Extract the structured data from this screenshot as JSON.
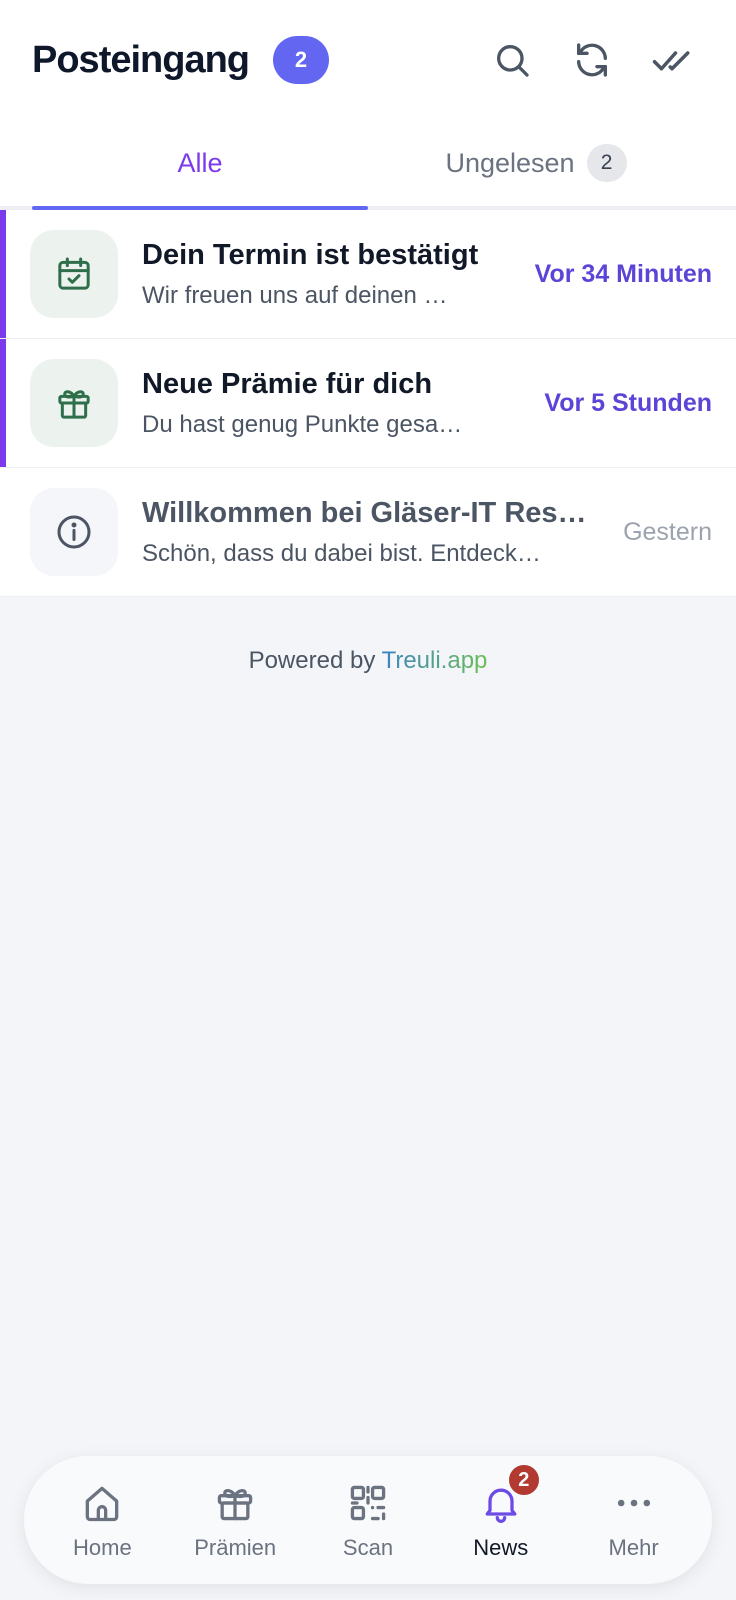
{
  "header": {
    "title": "Posteingang",
    "unread_count": "2",
    "actions": [
      "search-icon",
      "refresh-icon",
      "mark-all-read-icon"
    ]
  },
  "tabs": [
    {
      "label": "Alle",
      "active": true
    },
    {
      "label": "Ungelesen",
      "count": "2",
      "active": false
    }
  ],
  "messages": [
    {
      "icon": "calendar-check-icon",
      "title": "Dein Termin ist bestätigt",
      "preview": "Wir freuen uns auf deinen …",
      "time": "Vor 34 Minuten",
      "unread": true
    },
    {
      "icon": "gift-icon",
      "title": "Neue Prämie für dich",
      "preview": "Du hast genug Punkte gesa…",
      "time": "Vor 5 Stunden",
      "unread": true
    },
    {
      "icon": "info-icon",
      "title": "Willkommen bei Gläser-IT Res…",
      "preview": "Schön, dass du dabei bist. Entdeck…",
      "time": "Gestern",
      "unread": false
    }
  ],
  "footer": {
    "prefix": "Powered by ",
    "brand": "Treuli.app"
  },
  "bottom_nav": [
    {
      "label": "Home",
      "icon": "home-icon"
    },
    {
      "label": "Prämien",
      "icon": "gift-icon"
    },
    {
      "label": "Scan",
      "icon": "qr-code-icon"
    },
    {
      "label": "News",
      "icon": "bell-icon",
      "badge": "2",
      "active": true
    },
    {
      "label": "Mehr",
      "icon": "more-dots-icon"
    }
  ],
  "colors": {
    "accent": "#6366f1",
    "unread_marker": "#7c3aed",
    "time_unread": "#5b45d6",
    "icon_green": "#2f6e4a",
    "nav_badge": "#b23a31"
  }
}
